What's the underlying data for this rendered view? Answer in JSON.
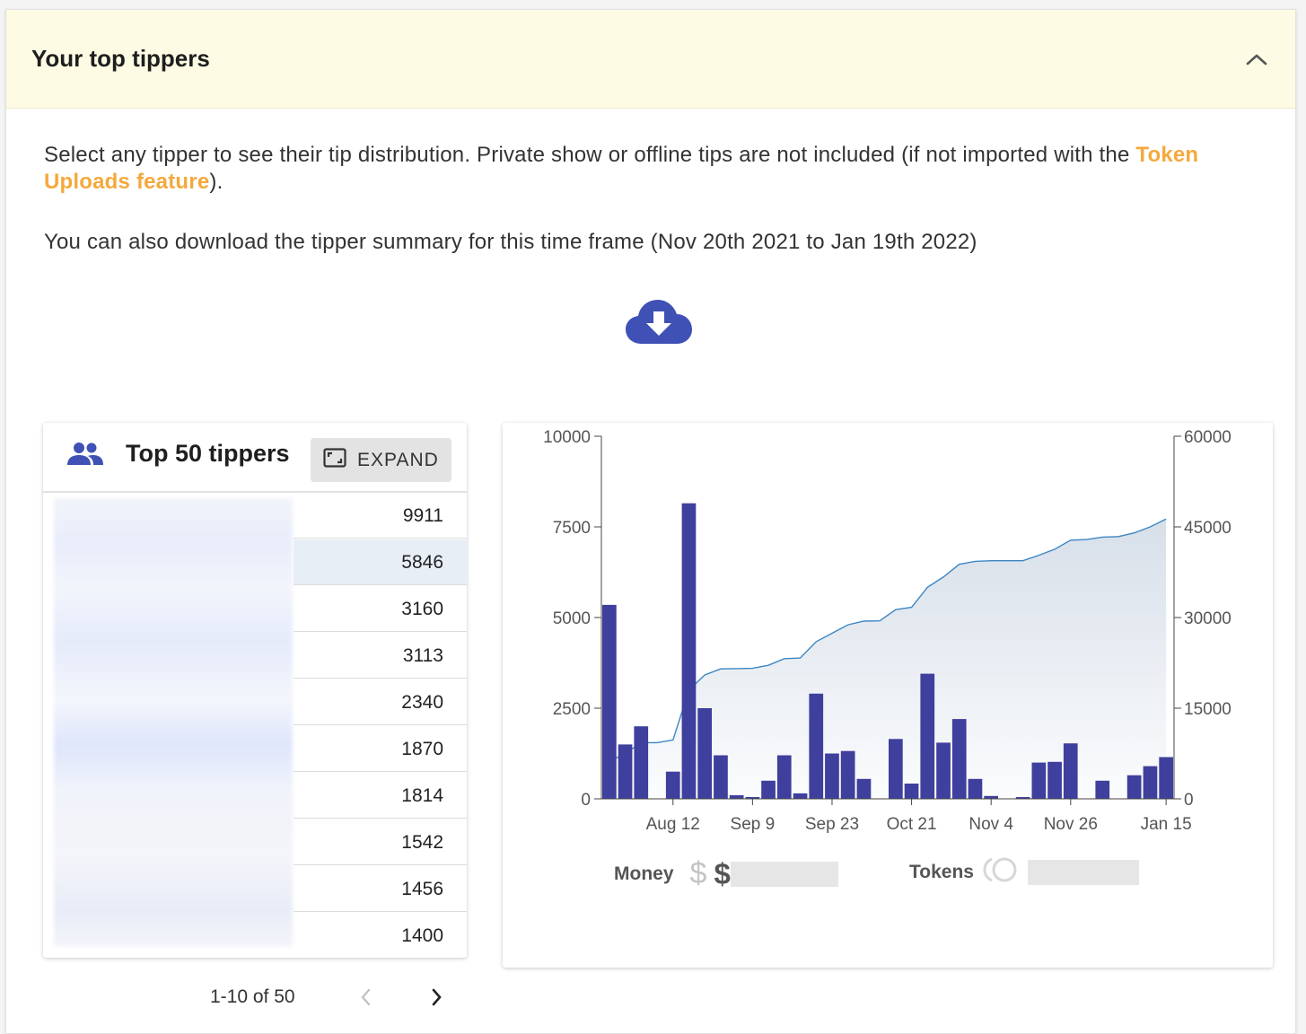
{
  "panel": {
    "title": "Your top tippers",
    "intro_text_1": "Select any tipper to see their tip distribution. Private show or offline tips are not included (if not imported with the ",
    "intro_link": "Token Uploads feature",
    "intro_text_1_end": ").",
    "intro_text_2": "You can also download the tipper summary for this time frame (Nov 20th 2021 to Jan 19th 2022)"
  },
  "tippers": {
    "title": "Top 50 tippers",
    "expand_label": "EXPAND",
    "values": [
      "9911",
      "5846",
      "3160",
      "3113",
      "2340",
      "1870",
      "1814",
      "1542",
      "1456",
      "1400"
    ],
    "selected_index": 1,
    "pagination": "1-10 of 50"
  },
  "summary": {
    "money_label": "Money",
    "money_symbol": "$",
    "money_visible": "$",
    "tokens_label": "Tokens"
  },
  "colors": {
    "bar": "#3f3f9d",
    "line": "#3b86c4",
    "accent_link": "#f4a93c",
    "header_bg": "#fdfbe3",
    "icon_blue": "#3f51b5"
  },
  "chart_data": {
    "type": "bar",
    "x_tick_labels": [
      "Aug 12",
      "Sep 9",
      "Sep 23",
      "Oct 21",
      "Nov 4",
      "Nov 26",
      "Jan 15"
    ],
    "left_axis": {
      "ticks": [
        0,
        2500,
        5000,
        7500,
        10000
      ],
      "ylim": [
        0,
        10000
      ]
    },
    "right_axis": {
      "ticks": [
        0,
        15000,
        30000,
        45000,
        60000
      ],
      "ylim": [
        0,
        60000
      ]
    },
    "series": [
      {
        "type": "bar",
        "axis": "left",
        "values": [
          5350,
          1500,
          2000,
          0,
          750,
          8150,
          2500,
          1200,
          100,
          50,
          500,
          1200,
          150,
          2900,
          1250,
          1320,
          550,
          0,
          1650,
          420,
          3450,
          1550,
          2200,
          550,
          80,
          0,
          50,
          1000,
          1020,
          1530,
          0,
          500,
          0,
          650,
          900,
          1150
        ]
      },
      {
        "type": "area",
        "axis": "right",
        "values": [
          6200,
          7500,
          9300,
          9300,
          9750,
          18000,
          20500,
          21500,
          21550,
          21600,
          22100,
          23200,
          23300,
          26000,
          27400,
          28800,
          29400,
          29450,
          31300,
          31700,
          35000,
          36700,
          38800,
          39300,
          39400,
          39400,
          39400,
          40300,
          41300,
          42800,
          42900,
          43300,
          43400,
          44000,
          45000,
          46300
        ]
      }
    ]
  }
}
